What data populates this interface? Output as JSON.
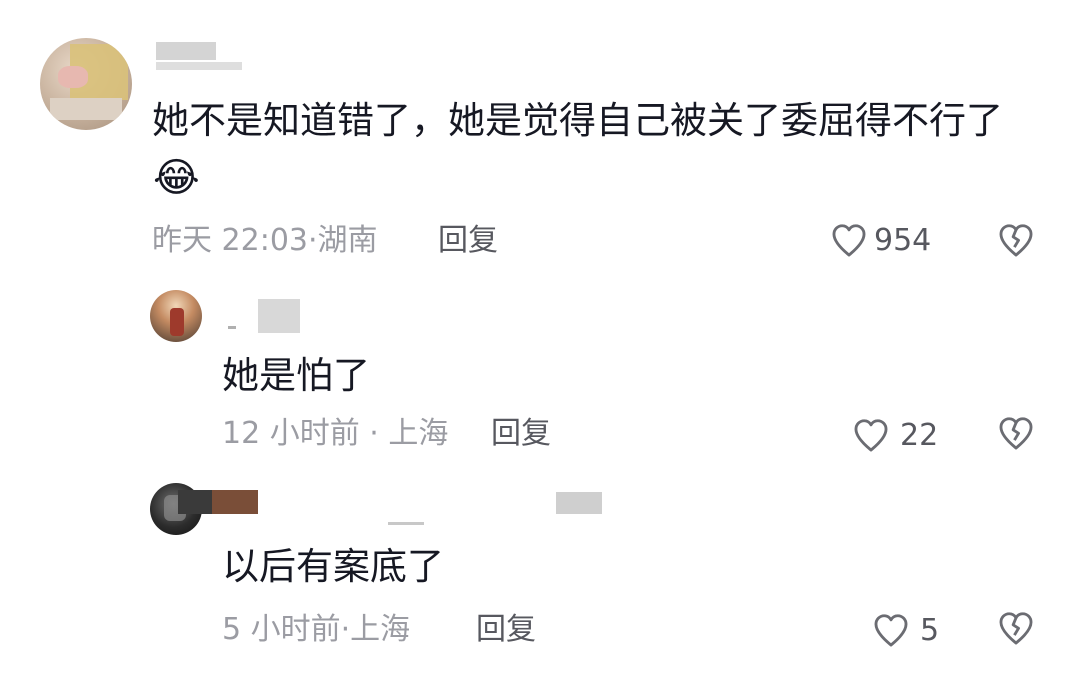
{
  "comments": [
    {
      "text": "她不是知道错了，她是觉得自己被关了委屈得不行了",
      "emoji": "😂",
      "time": "昨天 22:03",
      "location": "湖南",
      "reply_label": "回复",
      "likes": "954"
    },
    {
      "text": "她是怕了",
      "time": "12 小时前",
      "location": "上海",
      "reply_label": "回复",
      "likes": "22"
    },
    {
      "text": "以后有案底了",
      "time": "5 小时前",
      "location": "上海",
      "reply_label": "回复",
      "likes": "5"
    }
  ],
  "separator": "·",
  "icons": {
    "like": "heart-outline-icon",
    "dislike": "broken-heart-icon"
  }
}
